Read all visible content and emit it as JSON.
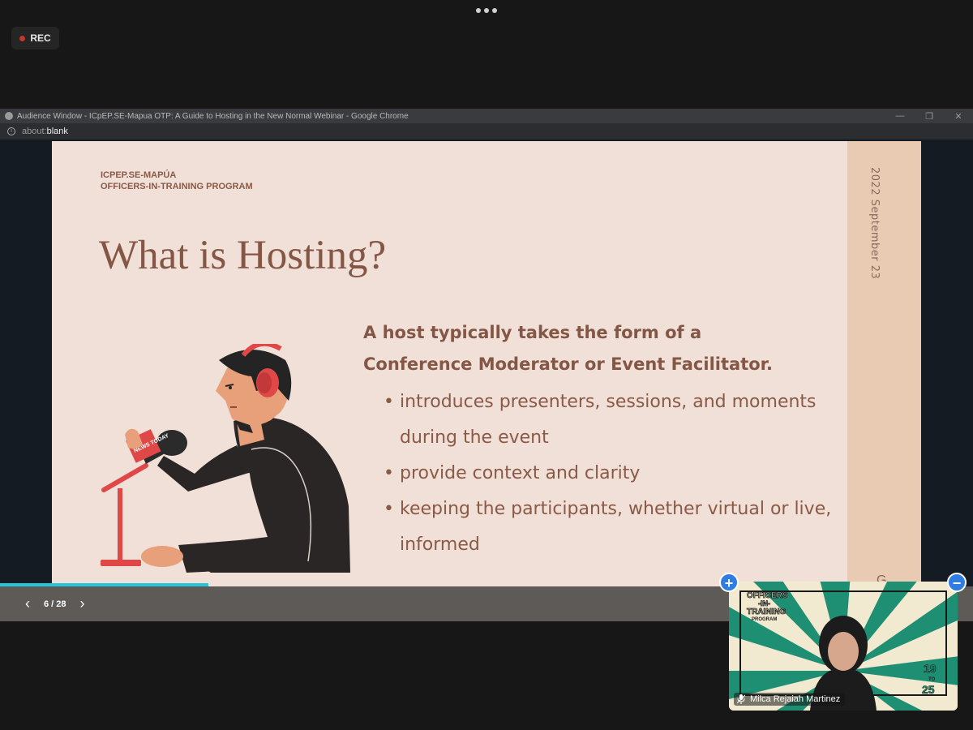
{
  "meeting": {
    "rec_label": "REC"
  },
  "browser": {
    "window_title": "Audience Window - ICpEP.SE-Mapua OTP: A Guide to Hosting in the New Normal Webinar - Google Chrome",
    "url_scheme": "about:",
    "url_host": "blank",
    "controls": {
      "minimize": "—",
      "restore": "❐",
      "close": "✕"
    }
  },
  "slide": {
    "org_line1": "ICPEP.SE-MAPÚA",
    "org_line2": "OFFICERS-IN-TRAINING PROGRAM",
    "title": "What is Hosting?",
    "lead_line1": "A host typically takes the form of a",
    "lead_line2": "Conference Moderator or Event Facilitator.",
    "bullets": [
      "introduces presenters, sessions, and moments during the event",
      "provide context and clarity",
      "keeping the participants, whether virtual or live, informed"
    ],
    "side_date": "2022 September 23",
    "side_letter": "G",
    "mic_text": "NEWS TODAY"
  },
  "viewer": {
    "page_indicator": "6 / 28",
    "current_page": 6,
    "total_pages": 28,
    "prev_icon": "‹",
    "next_icon": "›",
    "progress_color": "#26c6da"
  },
  "video": {
    "participant_name": "Milca Rejaiah Martinez",
    "banner_line1": "OFFICERS",
    "banner_line2": "-IN-",
    "banner_line3": "TRAINING",
    "banner_line4": "PROGRAM",
    "banner_date_top": "19",
    "banner_date_mid": "TO",
    "banner_date_bottom": "25",
    "add_icon": "+",
    "minimize_icon": "−"
  },
  "colors": {
    "slide_bg": "#f1e0d7",
    "slide_text": "#845645",
    "side_strip": "#e9cbb4",
    "video_green": "#1f8f74",
    "video_cream": "#f2ead0"
  }
}
